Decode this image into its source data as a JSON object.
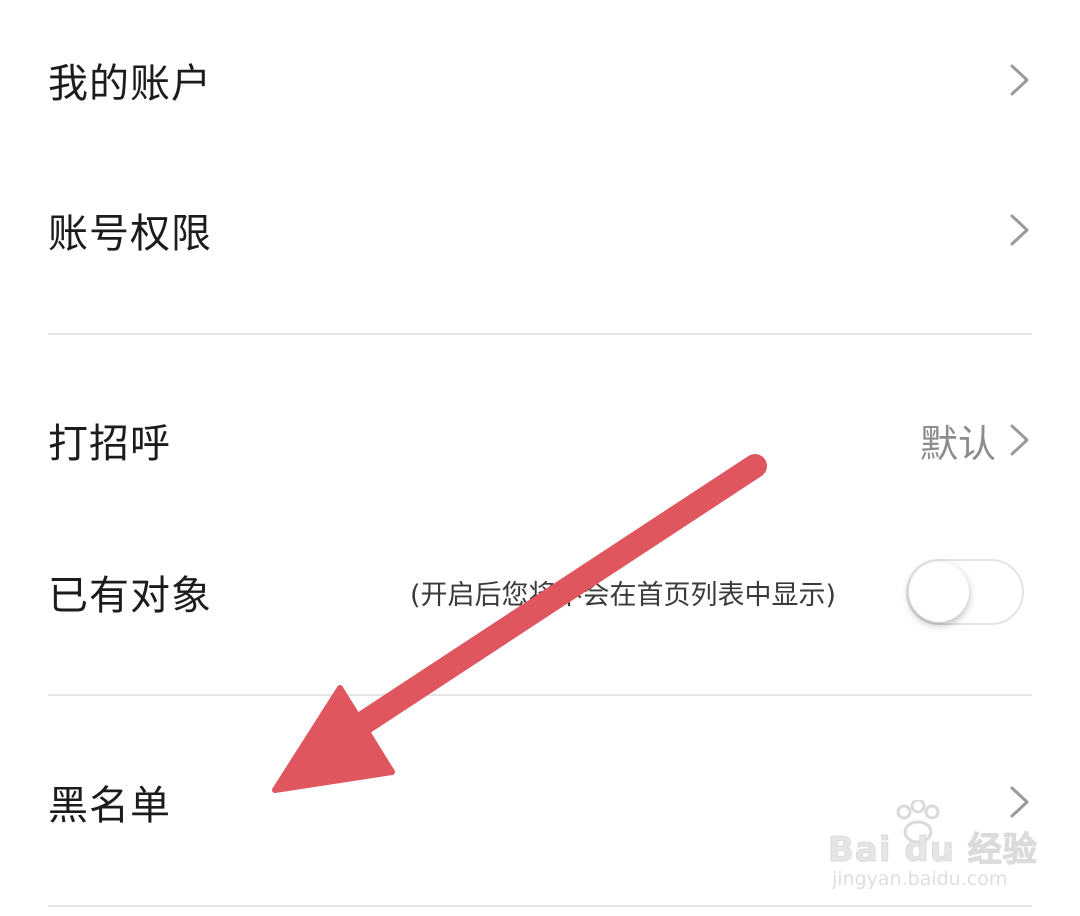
{
  "settings": {
    "items": [
      {
        "label": "我的账户"
      },
      {
        "label": "账号权限"
      },
      {
        "label": "打招呼",
        "value": "默认"
      },
      {
        "label": "已有对象",
        "hint": "(开启后您将不会在首页列表中显示)",
        "toggle_on": false
      },
      {
        "label": "黑名单"
      }
    ]
  },
  "colors": {
    "annotation_arrow": "#e0565f",
    "divider": "#e6e6e6",
    "label_text": "#1c1c1c",
    "value_text": "#8c8c8c",
    "chevron": "#9a9a9a"
  },
  "icons": {
    "chevron": "chevron-right-icon",
    "watermark_paw": "paw-icon"
  },
  "watermark": {
    "brand": "Bai du 经验",
    "url": "jingyan.baidu.com"
  }
}
